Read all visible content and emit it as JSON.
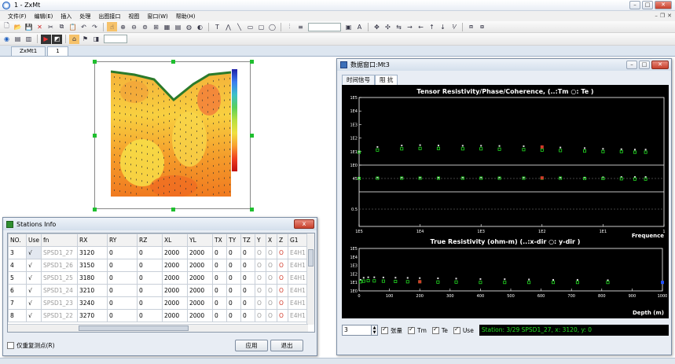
{
  "window": {
    "title": "1 - ZxMt"
  },
  "menu": [
    "文件(F)",
    "编辑(E)",
    "插入",
    "处理",
    "出图接口",
    "视图",
    "窗口(W)",
    "帮助(H)"
  ],
  "doc_tabs": [
    "ZxMt1",
    "1"
  ],
  "colors": {
    "accent": "#3c6fb8",
    "plot_bg": "#000000",
    "data_green": "#22dd22",
    "marker_red": "#d23a2a"
  },
  "stations": {
    "title": "Stations Info",
    "close_label": "x",
    "columns": [
      "NO.",
      "Use",
      "fn",
      "RX",
      "RY",
      "RZ",
      "XL",
      "YL",
      "TX",
      "TY",
      "TZ",
      "Y",
      "X",
      "Z",
      "G1"
    ],
    "rows": [
      [
        "3",
        "√",
        "SPSD1_27",
        "3120",
        "0",
        "0",
        "2000",
        "2000",
        "0",
        "0",
        "0",
        "O",
        "O",
        "O",
        "E4H1"
      ],
      [
        "4",
        "√",
        "SPSD1_26",
        "3150",
        "0",
        "0",
        "2000",
        "2000",
        "0",
        "0",
        "0",
        "O",
        "O",
        "O",
        "E4H1"
      ],
      [
        "5",
        "√",
        "SPSD1_25",
        "3180",
        "0",
        "0",
        "2000",
        "2000",
        "0",
        "0",
        "0",
        "O",
        "O",
        "O",
        "E4H1"
      ],
      [
        "6",
        "√",
        "SPSD1_24",
        "3210",
        "0",
        "0",
        "2000",
        "2000",
        "0",
        "0",
        "0",
        "O",
        "O",
        "O",
        "E4H1"
      ],
      [
        "7",
        "√",
        "SPSD1_23",
        "3240",
        "0",
        "0",
        "2000",
        "2000",
        "0",
        "0",
        "0",
        "O",
        "O",
        "O",
        "E4H1"
      ],
      [
        "8",
        "√",
        "SPSD1_22",
        "3270",
        "0",
        "0",
        "2000",
        "2000",
        "0",
        "0",
        "0",
        "O",
        "O",
        "O",
        "E4H1"
      ]
    ],
    "checkbox_label": "仅重复测点(R)",
    "apply_label": "应用",
    "exit_label": "退出"
  },
  "datawin": {
    "title": "数据窗口:Mt3",
    "tabs": [
      "时间信号",
      "阻 抗"
    ],
    "active_tab": 1,
    "status_value": "3",
    "check_tensor": "张量",
    "check_tm": "Tm",
    "check_te": "Te",
    "check_use": "Use",
    "status_text": "Station: 3/29  SPSD1_27, x: 3120, y: 0"
  },
  "chart_data": [
    {
      "type": "scatter",
      "title": "Tensor Resistivity/Phase/Coherence, (..:Tm ○: Te )",
      "xlabel": "Frequence",
      "x_ticklabels": [
        "1E5",
        "1E4",
        "1E3",
        "1E2",
        "1E1",
        "1"
      ],
      "y_ticklabels_resistivity": [
        "1E5",
        "1E4",
        "1E3",
        "1E2",
        "1E1",
        "1E0"
      ],
      "y_ticklabels_phase": [
        "45"
      ],
      "y_ticklabels_coherence": [
        "0.5"
      ],
      "xlim": [
        100000,
        1
      ],
      "log_x": true,
      "series": [
        {
          "name": "Tm",
          "panel": "resistivity",
          "x": [
            100000,
            50000,
            20000,
            10000,
            5000,
            2000,
            1000,
            500,
            200,
            100,
            50,
            20,
            10,
            5,
            3,
            2
          ],
          "y": [
            10,
            22,
            28,
            30,
            28,
            27,
            27,
            26,
            25,
            22,
            20,
            18,
            16,
            15,
            14,
            14
          ]
        },
        {
          "name": "Te",
          "panel": "resistivity",
          "x": [
            100000,
            50000,
            20000,
            10000,
            5000,
            2000,
            1000,
            500,
            200,
            100,
            50,
            20,
            10,
            5,
            3,
            2
          ],
          "y": [
            9,
            13,
            16,
            17,
            17,
            16,
            16,
            15,
            14,
            13,
            12,
            11,
            10,
            10,
            9,
            9
          ]
        },
        {
          "name": "Tm",
          "panel": "phase",
          "x": [
            100000,
            50000,
            20000,
            10000,
            5000,
            2000,
            1000,
            500,
            200,
            100,
            50,
            20,
            10,
            5,
            3,
            2
          ],
          "y": [
            47,
            48,
            48,
            48,
            48,
            48,
            48,
            48,
            48,
            48,
            48,
            48,
            49,
            50,
            50,
            50
          ]
        },
        {
          "name": "Te",
          "panel": "phase",
          "x": [
            100000,
            50000,
            20000,
            10000,
            5000,
            2000,
            1000,
            500,
            200,
            100,
            50,
            20,
            10,
            5,
            3,
            2
          ],
          "y": [
            45,
            46,
            46,
            46,
            46,
            46,
            46,
            46,
            46,
            46,
            46,
            45,
            45,
            44,
            43,
            43
          ]
        }
      ]
    },
    {
      "type": "scatter",
      "title": "True Resistivity (ohm-m) (..:x-dir ○: y-dir )",
      "xlabel": "Depth (m)",
      "x_ticklabels": [
        "0",
        "100",
        "200",
        "300",
        "400",
        "500",
        "600",
        "700",
        "800",
        "900",
        "1000"
      ],
      "y_ticklabels": [
        "1E5",
        "1E4",
        "1E3",
        "1E2",
        "1E1",
        "1E0"
      ],
      "xlim": [
        0,
        1000
      ],
      "series": [
        {
          "name": "x-dir",
          "x": [
            5,
            15,
            30,
            50,
            80,
            120,
            160,
            200,
            260,
            320,
            400,
            480,
            560,
            640,
            720,
            820
          ],
          "y": [
            20,
            35,
            40,
            40,
            38,
            36,
            34,
            32,
            30,
            28,
            25,
            24,
            22,
            20,
            20,
            18
          ]
        },
        {
          "name": "y-dir",
          "x": [
            5,
            15,
            30,
            50,
            80,
            120,
            160,
            200,
            260,
            320,
            400,
            480,
            560,
            640,
            720,
            820
          ],
          "y": [
            12,
            14,
            16,
            15,
            14,
            13,
            12,
            12,
            11,
            11,
            10,
            10,
            10,
            10,
            10,
            10
          ]
        }
      ]
    }
  ]
}
